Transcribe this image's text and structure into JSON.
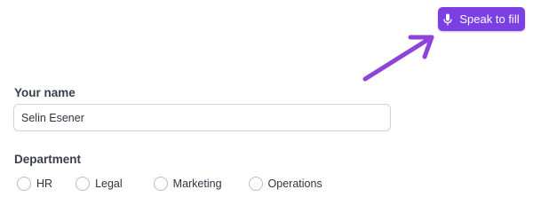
{
  "speak_button": {
    "label": "Speak to fill",
    "icon": "microphone-icon"
  },
  "annotation": {
    "icon": "arrow-icon",
    "color": "#8e44d8"
  },
  "name_field": {
    "label": "Your name",
    "value": "Selin Esener"
  },
  "department": {
    "label": "Department",
    "options": [
      "HR",
      "Legal",
      "Marketing",
      "Operations"
    ],
    "selected": null
  },
  "colors": {
    "accent": "#7b3fe4",
    "annotation": "#8e44d8"
  }
}
